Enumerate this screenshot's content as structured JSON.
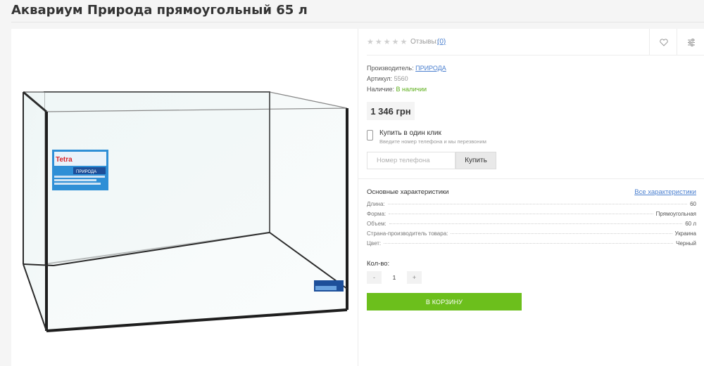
{
  "product": {
    "title": "Аквариум Природа прямоугольный 65 л",
    "image_alt": "Аквариум Природа прямоугольный 65 л",
    "label_brand": "Tetra",
    "label_name": "ПРИРОДА"
  },
  "reviews": {
    "stars": "★★★★★",
    "label": "Отзывы:",
    "count": "(0)"
  },
  "meta": {
    "manufacturer_label": "Производитель:",
    "manufacturer_value": "ПРИРОДА",
    "sku_label": "Артикул:",
    "sku_value": "5560",
    "availability_label": "Наличие:",
    "availability_value": "В наличии"
  },
  "price": "1 346 грн",
  "one_click": {
    "title": "Купить в один клик",
    "subtitle": "Введите номер телефона и мы перезвоним",
    "placeholder": "Номер телефона",
    "button": "Купить"
  },
  "specs": {
    "title": "Основные характеристики",
    "all_link": "Все характеристики",
    "rows": [
      {
        "label": "Длина:",
        "value": "60"
      },
      {
        "label": "Форма:",
        "value": "Прямоугольная"
      },
      {
        "label": "Объем:",
        "value": "60 л"
      },
      {
        "label": "Страна-производитель товара:",
        "value": "Украина"
      },
      {
        "label": "Цвет:",
        "value": "Черный"
      }
    ]
  },
  "quantity": {
    "label": "Кол-во:",
    "minus": "-",
    "value": "1",
    "plus": "+"
  },
  "cart_button": "В КОРЗИНУ",
  "colors": {
    "accent_green": "#6cbf1c",
    "link_blue": "#4a7fcf",
    "in_stock_green": "#5cae1a"
  }
}
